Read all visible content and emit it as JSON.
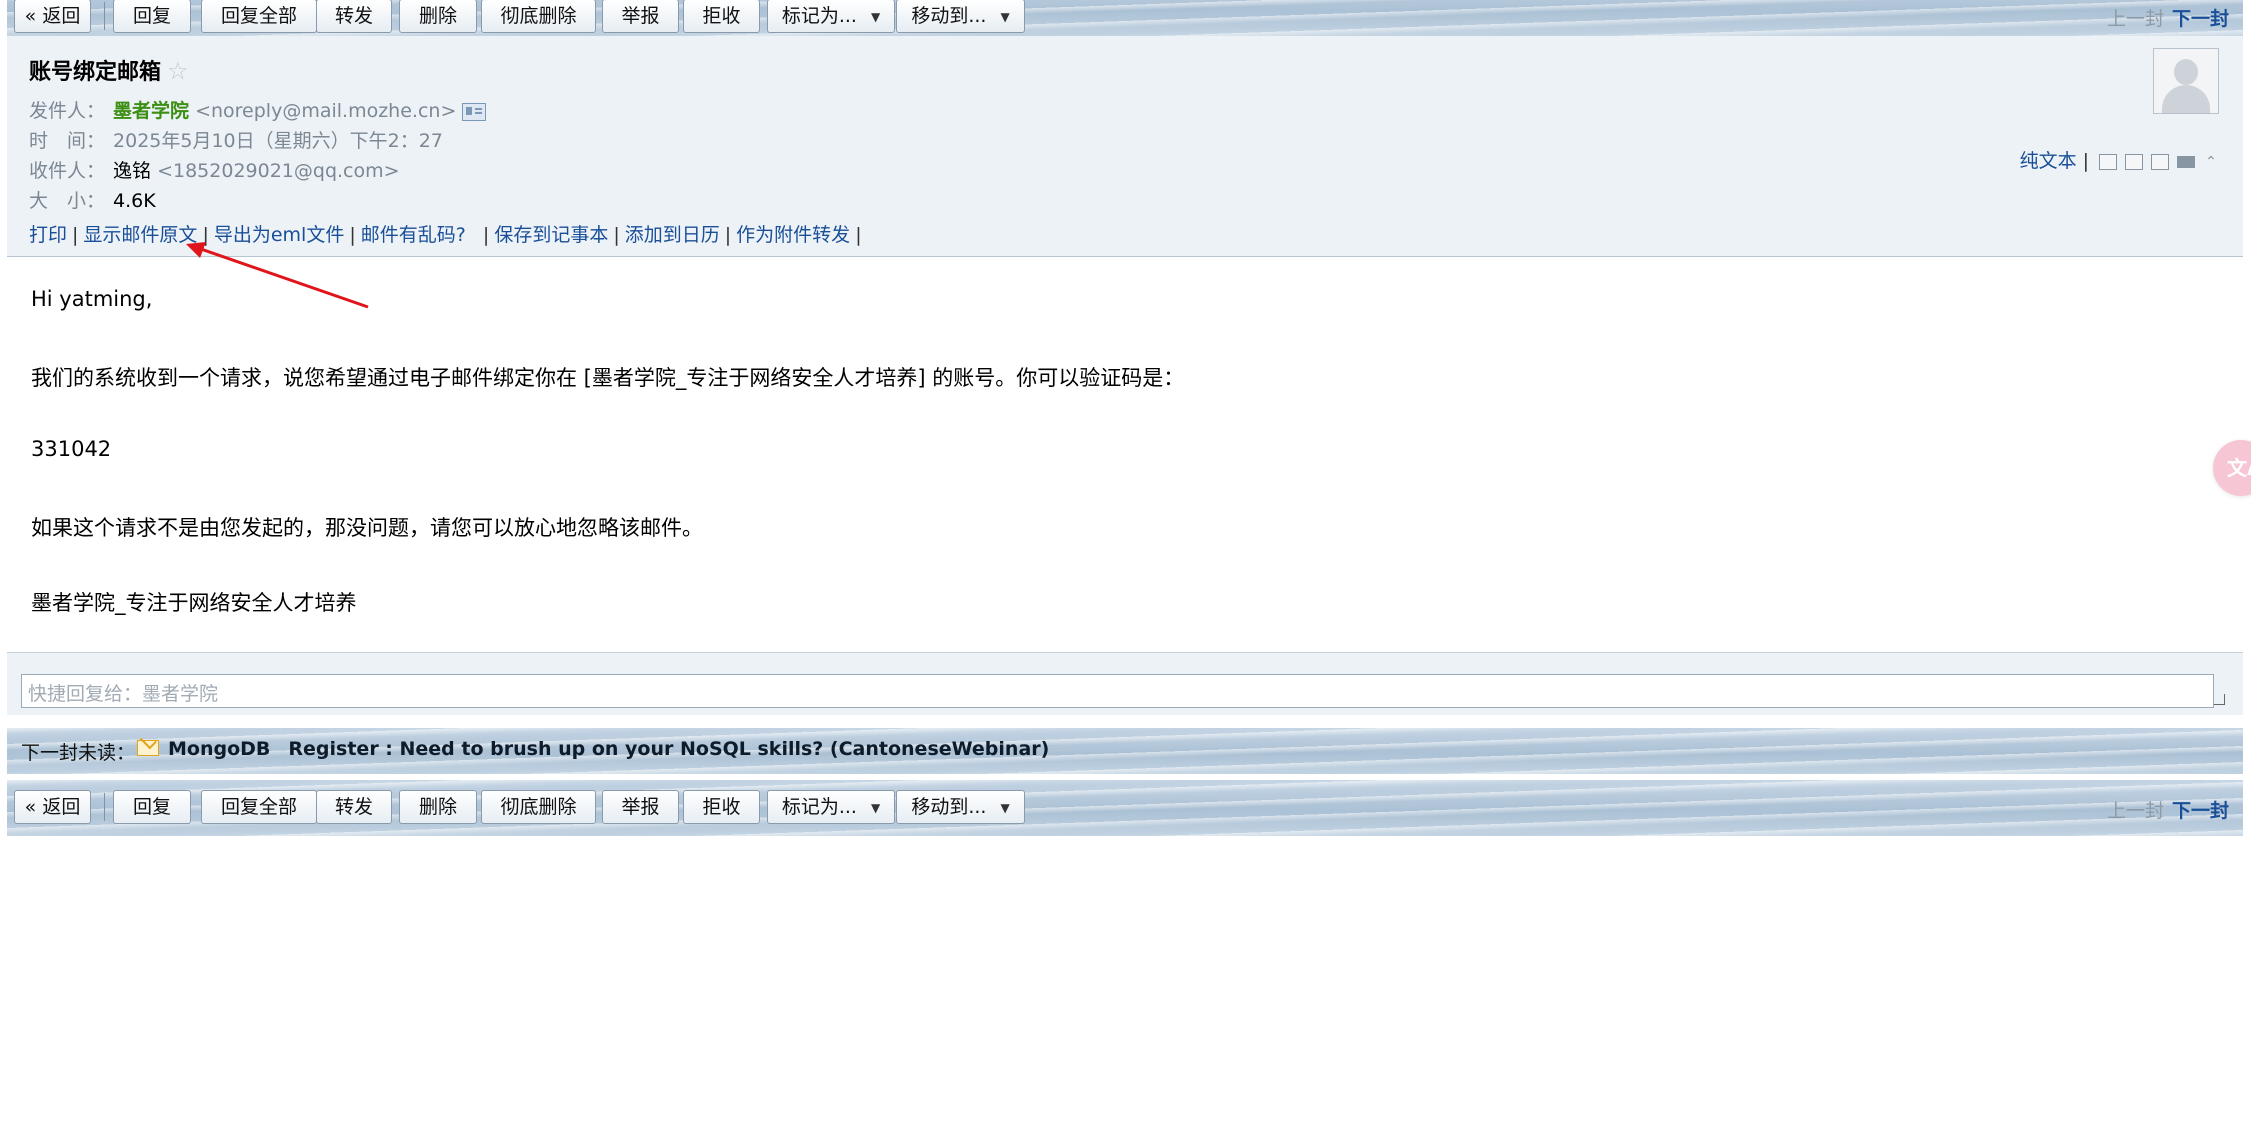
{
  "toolbar": {
    "back": "« 返回",
    "reply": "回复",
    "reply_all": "回复全部",
    "forward": "转发",
    "delete": "删除",
    "delete_permanent": "彻底删除",
    "report": "举报",
    "reject": "拒收",
    "mark_as": "标记为...",
    "move_to": "移动到...",
    "prev": "上一封",
    "next": "下一封"
  },
  "email": {
    "subject": "账号绑定邮箱",
    "star_icon": "☆",
    "from_label": "发件人：",
    "from_name": "墨者学院",
    "from_addr": "<noreply@mail.mozhe.cn>",
    "time_label": "时　间：",
    "time_value": "2025年5月10日（星期六）下午2：27",
    "to_label": "收件人：",
    "to_name": "逸铭",
    "to_addr": "<1852029021@qq.com>",
    "size_label": "大　小：",
    "size_value": "4.6K"
  },
  "actions": {
    "print": "打印",
    "show_source": "显示邮件原文",
    "export_eml": "导出为eml文件",
    "garbled": "邮件有乱码?",
    "save_note": "保存到记事本",
    "add_calendar": "添加到日历",
    "forward_attachment": "作为附件转发",
    "sep": "|"
  },
  "view": {
    "plain_text": "纯文本",
    "sep": "|",
    "collapse_icon": "⌃"
  },
  "body": {
    "greeting": "Hi yatming,",
    "line1": "我们的系统收到一个请求，说您希望通过电子邮件绑定你在 [墨者学院_专注于网络安全人才培养] 的账号。你可以验证码是：",
    "code": "331042",
    "line2": "如果这个请求不是由您发起的，那没问题，请您可以放心地忽略该邮件。",
    "signature": "墨者学院_专注于网络安全人才培养"
  },
  "quick_reply": {
    "placeholder": "快捷回复给：墨者学院"
  },
  "next_unread": {
    "label": "下一封未读：",
    "sender": "MongoDB",
    "subject": "Register : Need to brush up on your NoSQL skills? (CantoneseWebinar)"
  },
  "translate_fab": {
    "icon": "文A"
  },
  "colors": {
    "link": "#1a4f98",
    "sender": "#3b8f12",
    "annotation_arrow": "#e0141a"
  }
}
